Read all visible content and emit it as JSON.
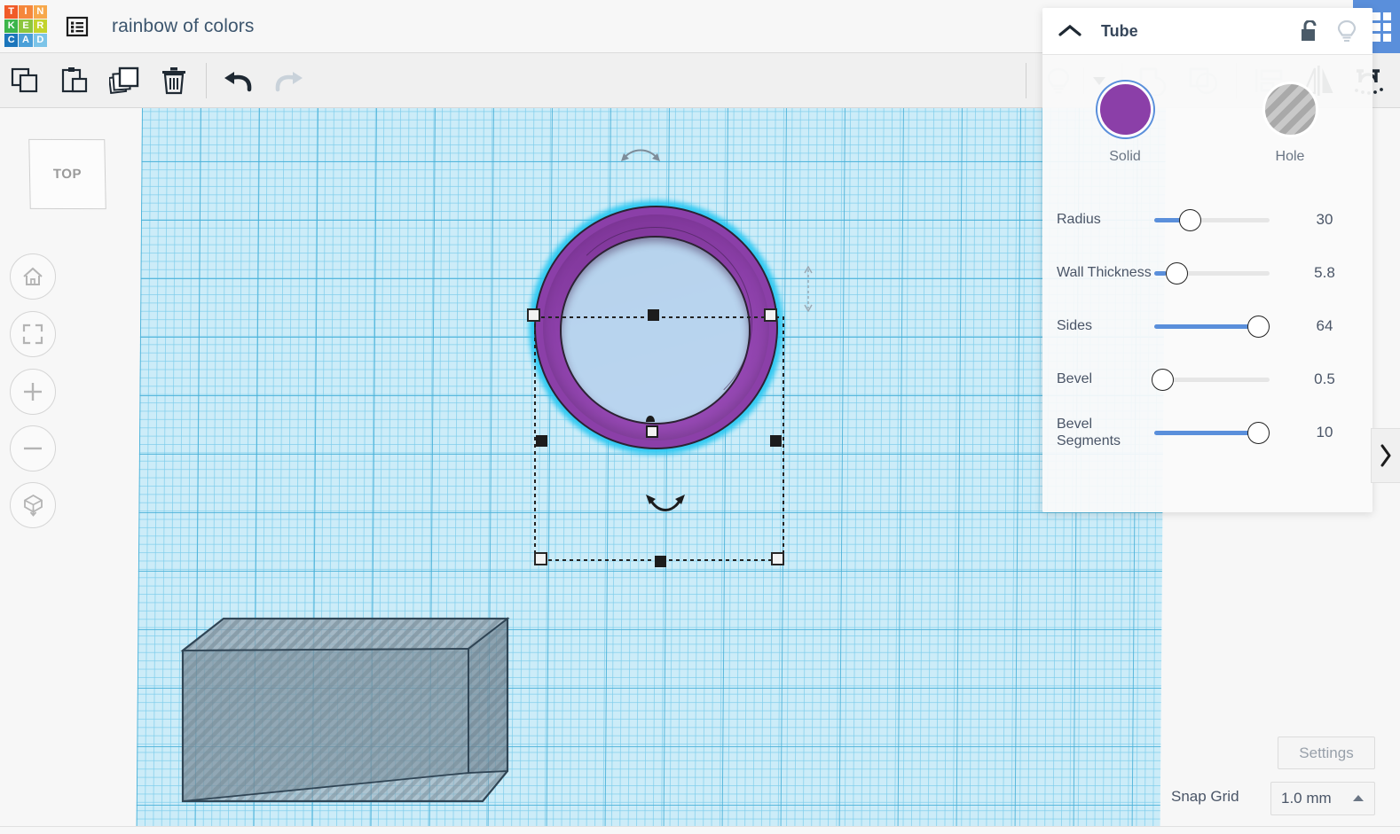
{
  "app": {
    "logo_letters": [
      {
        "ch": "T",
        "color": "#f05a28"
      },
      {
        "ch": "I",
        "color": "#f5873b"
      },
      {
        "ch": "N",
        "color": "#f7a84b"
      },
      {
        "ch": "K",
        "color": "#3cb54a"
      },
      {
        "ch": "E",
        "color": "#8cc63e"
      },
      {
        "ch": "R",
        "color": "#c3d32c"
      },
      {
        "ch": "C",
        "color": "#1b75bb"
      },
      {
        "ch": "A",
        "color": "#4a9fd8"
      },
      {
        "ch": "D",
        "color": "#7cc4e8"
      }
    ],
    "menu_icon": "list-menu-icon",
    "document_title": "rainbow of colors",
    "apps_icon": "apps-grid-icon",
    "accent_blue": "#5a8fdb"
  },
  "toolbar": {
    "left_buttons": [
      {
        "name": "copy-button",
        "icon": "copy-icon",
        "enabled": true
      },
      {
        "name": "paste-button",
        "icon": "paste-icon",
        "enabled": true
      },
      {
        "name": "duplicate-button",
        "icon": "duplicate-icon",
        "enabled": true
      },
      {
        "name": "delete-button",
        "icon": "trash-icon",
        "enabled": true
      },
      {
        "name": "undo-button",
        "icon": "undo-arrow-icon",
        "enabled": true
      },
      {
        "name": "redo-button",
        "icon": "redo-arrow-icon",
        "enabled": false
      }
    ],
    "right_buttons": [
      {
        "name": "light-toggle-button",
        "icon": "lightbulb-icon",
        "enabled": false
      },
      {
        "name": "light-dropdown-button",
        "icon": "caret-down-icon",
        "enabled": true
      },
      {
        "name": "group-button",
        "icon": "group-shapes-icon",
        "enabled": false
      },
      {
        "name": "ungroup-button",
        "icon": "ungroup-shapes-icon",
        "enabled": false
      },
      {
        "name": "align-button",
        "icon": "align-icon",
        "enabled": false
      },
      {
        "name": "mirror-button",
        "icon": "mirror-flip-icon",
        "enabled": true
      },
      {
        "name": "snap-magnet-button",
        "icon": "magnet-icon",
        "enabled": true
      }
    ]
  },
  "viewport": {
    "view_cube_label": "TOP",
    "nav_buttons": [
      {
        "name": "home-view-button",
        "icon": "home-icon"
      },
      {
        "name": "fit-to-view-button",
        "icon": "fit-frame-icon"
      },
      {
        "name": "zoom-in-button",
        "icon": "plus-icon"
      },
      {
        "name": "zoom-out-button",
        "icon": "minus-icon"
      },
      {
        "name": "projection-toggle-button",
        "icon": "cube-projection-icon"
      }
    ],
    "objects": [
      {
        "name": "tube-shape",
        "type": "tube",
        "color": "#8b3fa8",
        "selected": true
      },
      {
        "name": "hole-box-shape",
        "type": "box",
        "color": "#8c9aa6",
        "selected": false
      }
    ],
    "grid_color": "#46afd7",
    "workplane_color": "#ccecf8"
  },
  "panel": {
    "title": "Tube",
    "collapse_icon": "chevron-up-icon",
    "lock_icon": "unlock-icon",
    "visibility_icon": "lightbulb-icon",
    "modes": [
      {
        "label": "Solid",
        "name": "solid-swatch",
        "selected": true,
        "color": "#8b3fa8"
      },
      {
        "label": "Hole",
        "name": "hole-swatch",
        "selected": false,
        "color": "#b9b9b9"
      }
    ],
    "params": [
      {
        "label": "Radius",
        "value": "30",
        "fill_pct": 27,
        "knob_pct": 31,
        "name": "radius"
      },
      {
        "label": "Wall Thickness",
        "value": "5.8",
        "fill_pct": 11,
        "knob_pct": 19,
        "name": "wall-thickness"
      },
      {
        "label": "Sides",
        "value": "64",
        "fill_pct": 89,
        "knob_pct": 90,
        "name": "sides"
      },
      {
        "label": "Bevel",
        "value": "0.5",
        "fill_pct": 1,
        "knob_pct": 7,
        "name": "bevel"
      },
      {
        "label": "Bevel Segments",
        "value": "10",
        "fill_pct": 89,
        "knob_pct": 90,
        "name": "bevel-segments"
      }
    ],
    "expand_tab_icon": "chevron-right-icon"
  },
  "footer": {
    "settings_label": "Settings",
    "snap_grid_label": "Snap Grid",
    "snap_grid_value": "1.0 mm",
    "snap_caret_icon": "caret-up-icon"
  }
}
